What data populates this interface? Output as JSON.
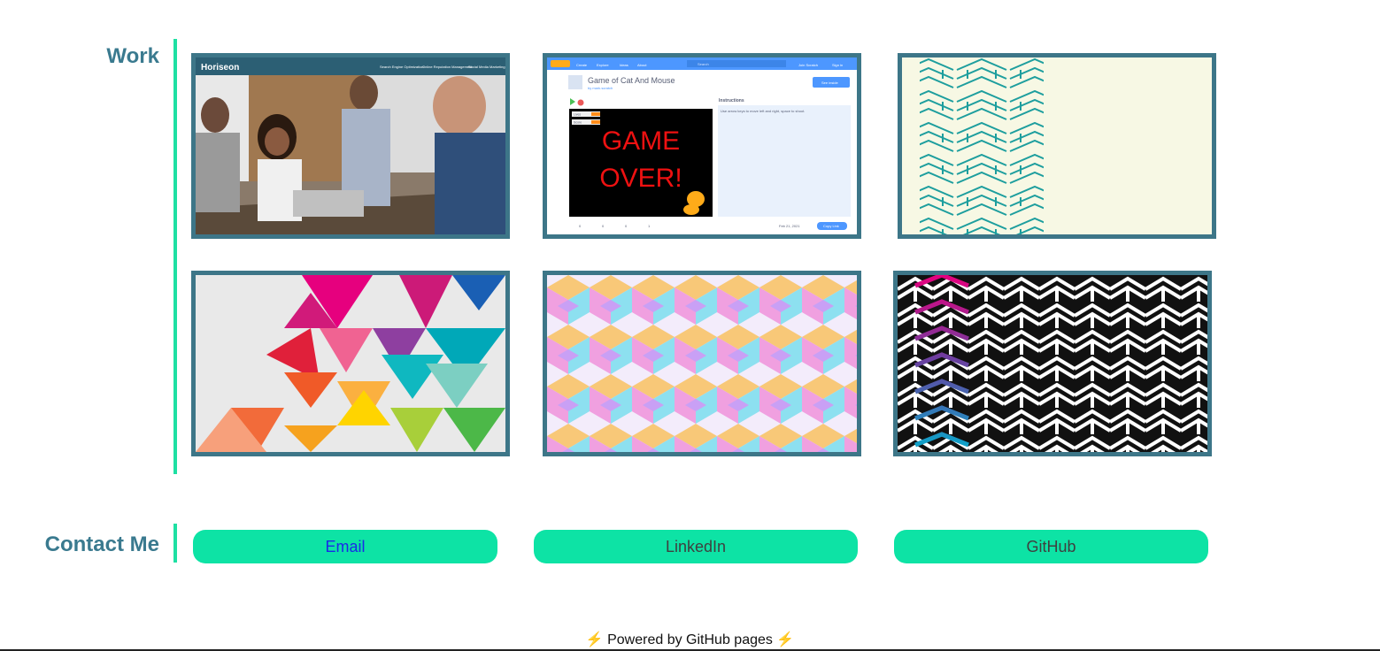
{
  "work": {
    "title": "Work",
    "projects": [
      {
        "icon": "office-team-photo",
        "header_brand": "Horiseon",
        "nav_items": [
          "Search Engine Optimization",
          "Online Reputation Management",
          "Social Media Marketing"
        ]
      },
      {
        "icon": "scratch-game-screenshot",
        "nav_items": [
          "Create",
          "Explore",
          "Ideas",
          "About"
        ],
        "search_placeholder": "Search",
        "account_items": [
          "Join Scratch",
          "Sign in"
        ],
        "project_title": "Game of Cat And Mouse",
        "author": "by mark.scratch",
        "see_inside": "See inside",
        "instructions_title": "Instructions",
        "instructions_text": "Use arrow keys to move left and right, space to shoot.",
        "game_text": [
          "GAME",
          "OVER!"
        ],
        "variables": [
          "Lives",
          "Score"
        ],
        "stats": [
          "0",
          "0",
          "0",
          "1"
        ],
        "date": "Feb 21, 2021",
        "copy_link": "Copy Link"
      },
      {
        "icon": "teal-geometric-pattern"
      },
      {
        "icon": "colorful-triangles-pattern"
      },
      {
        "icon": "pastel-cubes-pattern"
      },
      {
        "icon": "black-white-arrows-pattern"
      }
    ]
  },
  "contact": {
    "title": "Contact Me",
    "links": [
      {
        "label": "Email"
      },
      {
        "label": "LinkedIn"
      },
      {
        "label": "GitHub"
      }
    ]
  },
  "footer": {
    "text": "Powered by GitHub pages",
    "icon": "lightning-icon"
  },
  "colors": {
    "accent": "#1ee0a3",
    "title": "#3a7a8f",
    "border": "#3d7688",
    "pill": "#0de3a5"
  }
}
